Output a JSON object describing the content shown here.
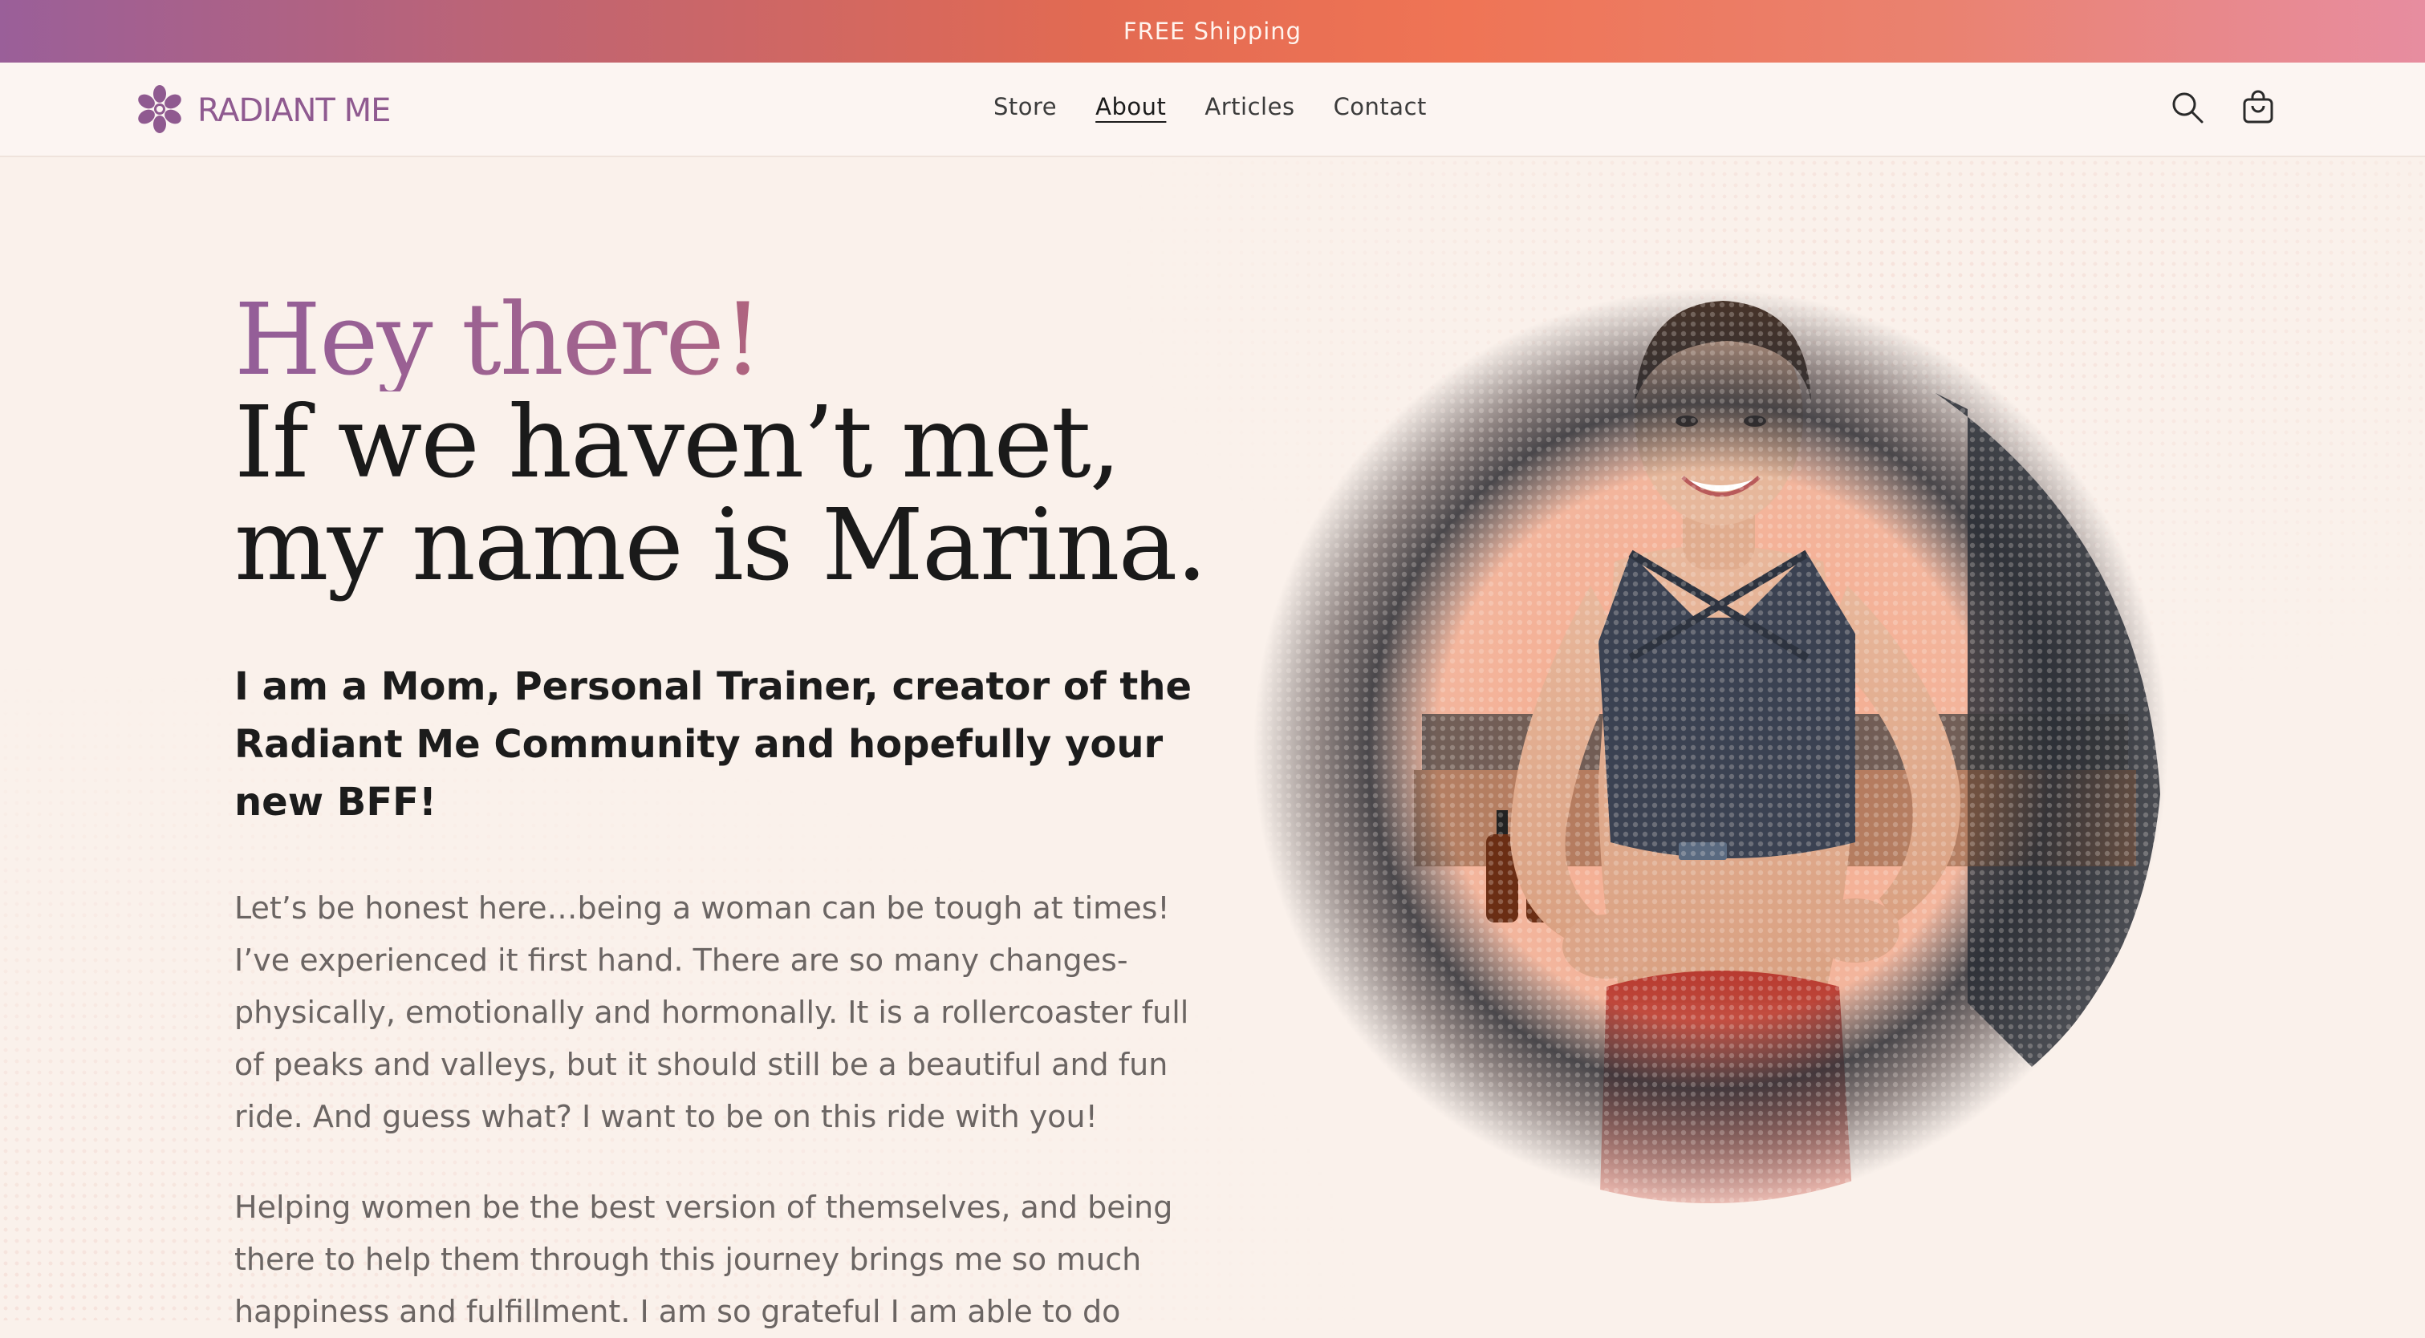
{
  "announcement": {
    "text": "FREE Shipping"
  },
  "header": {
    "brand": "RADIANT ME",
    "nav": [
      {
        "label": "Store",
        "active": false
      },
      {
        "label": "About",
        "active": true
      },
      {
        "label": "Articles",
        "active": false
      },
      {
        "label": "Contact",
        "active": false
      }
    ],
    "icons": {
      "search": "search-icon",
      "cart": "cart-icon",
      "logo": "flower-logo-icon"
    }
  },
  "hero": {
    "greeting": "Hey there!",
    "heading_line1": "If we haven’t met,",
    "heading_line2": "my name is Marina.",
    "intro": "I am a Mom, Personal Trainer, creator of the Radiant Me Community and hopefully your new BFF!",
    "paragraphs": [
      "Let’s be honest here…being a woman can be tough at times! I’ve experienced it first hand. There are so many changes-physically, emotionally and hormonally. It is a rollercoaster full of peaks and valleys, but it should still be a beautiful and fun ride. And guess what? I want to be on this ride with you!",
      "Helping women be the best version of themselves, and being there to help them through this journey brings me so much happiness and fulfillment. I am so grateful I am able to do"
    ]
  },
  "colors": {
    "brand_purple": "#8f5a90",
    "accent_orange": "#ee6a44",
    "page_bg": "#faf1eb",
    "body_text": "#6b6563",
    "heading_text": "#1a1a1a"
  }
}
